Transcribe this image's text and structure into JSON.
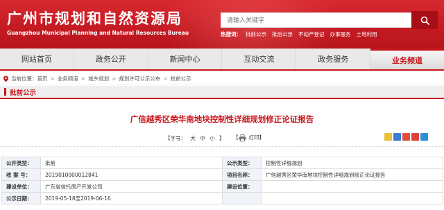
{
  "header": {
    "title": "广州市规划和自然资源局",
    "subtitle": "Guangzhou Municipal Planning and Natural Resources Bureau",
    "search_placeholder": "请输入关键字",
    "hotwords_label": "热搜词：",
    "hotwords": [
      "批前公示",
      "批后公示",
      "不动产登记",
      "办事服务",
      "土地利用"
    ]
  },
  "nav": {
    "items": [
      "网站首页",
      "政务公开",
      "新闻中心",
      "互动交流",
      "政务服务",
      "业务频道"
    ],
    "active_index": 5
  },
  "breadcrumb": {
    "prefix": "当前位置：",
    "items": [
      "首页",
      "业务频道",
      "城乡规划",
      "规划许可公示公布",
      "批前公示"
    ]
  },
  "section": {
    "title": "批前公示"
  },
  "article": {
    "title": "广信越秀区荣华南地块控制性详细规划修正论证报告",
    "font_label_prefix": "【字号：",
    "font_large": "大",
    "font_medium": "中",
    "font_small": "小",
    "font_label_suffix": "】",
    "print_label": "打印",
    "print_bracket_left": "【",
    "print_bracket_right": "】"
  },
  "info": {
    "rows": [
      {
        "l1": "公开类型：",
        "v1": "批前",
        "l2": "公示类型：",
        "v2": "控制性详细规划"
      },
      {
        "l1": "收 案 号：",
        "v1": "2019010000012841",
        "l2": "项目名称：",
        "v2": "广信越秀区荣华南地块控制性详细规划修正论证报告"
      },
      {
        "l1": "建设单位：",
        "v1": "广东省信托房产开发公司",
        "l2": "建设位置：",
        "v2": ""
      },
      {
        "l1": "公示日期：",
        "v1": "2019-05-18至2019-06-16",
        "l2": "",
        "v2": ""
      }
    ]
  },
  "colors": {
    "brand_red": "#c8161d",
    "share_colors": [
      "#e04e3e",
      "#3a7dd2",
      "#eab93a",
      "#d9443a",
      "#2d8fd5"
    ]
  },
  "share_icons": [
    "qzone-icon",
    "tencent-weibo-icon",
    "qq-icon",
    "sina-weibo-icon",
    "renren-icon"
  ]
}
